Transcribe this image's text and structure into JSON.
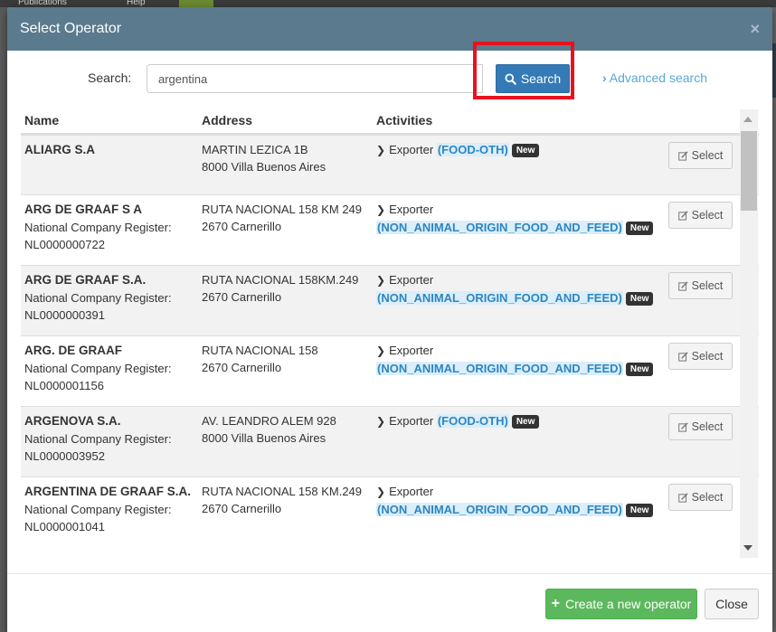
{
  "background": {
    "tab_publications": "Publications",
    "tab_help": "Help"
  },
  "modal": {
    "title": "Select Operator",
    "close_glyph": "×"
  },
  "search": {
    "label": "Search:",
    "value": "argentina",
    "button_label": "Search",
    "advanced_label": "Advanced search"
  },
  "table": {
    "headers": {
      "name": "Name",
      "address": "Address",
      "activities": "Activities"
    },
    "select_label": "Select",
    "rows": [
      {
        "name": "ALIARG S.A",
        "register": "",
        "address1": "MARTIN LEZICA 1B",
        "address2": "8000 Villa Buenos Aires",
        "activity": "Exporter",
        "code": "(FOOD-OTH)",
        "badge": "New"
      },
      {
        "name": "ARG DE GRAAF S A",
        "register": "National Company Register: NL0000000722",
        "address1": "RUTA NACIONAL 158 KM 249",
        "address2": "2670 Carnerillo",
        "activity": "Exporter",
        "code": "(NON_ANIMAL_ORIGIN_FOOD_AND_FEED)",
        "badge": "New"
      },
      {
        "name": "ARG DE GRAAF S.A.",
        "register": "National Company Register: NL0000000391",
        "address1": "RUTA NACIONAL 158KM.249",
        "address2": "2670 Carnerillo",
        "activity": "Exporter",
        "code": "(NON_ANIMAL_ORIGIN_FOOD_AND_FEED)",
        "badge": "New"
      },
      {
        "name": "ARG. DE GRAAF",
        "register": "National Company Register: NL0000001156",
        "address1": "RUTA NACIONAL 158",
        "address2": "2670 Carnerillo",
        "activity": "Exporter",
        "code": "(NON_ANIMAL_ORIGIN_FOOD_AND_FEED)",
        "badge": "New"
      },
      {
        "name": "ARGENOVA S.A.",
        "register": "National Company Register: NL0000003952",
        "address1": "AV. LEANDRO ALEM 928",
        "address2": "8000 Villa Buenos Aires",
        "activity": "Exporter",
        "code": "(FOOD-OTH)",
        "badge": "New"
      },
      {
        "name": "ARGENTINA DE GRAAF S.A.",
        "register": "National Company Register: NL0000001041",
        "address1": "RUTA NACIONAL 158 KM.249",
        "address2": "2670 Carnerillo",
        "activity": "Exporter",
        "code": "(NON_ANIMAL_ORIGIN_FOOD_AND_FEED)",
        "badge": "New"
      }
    ]
  },
  "footer": {
    "create_label": "Create a new operator",
    "close_label": "Close"
  },
  "colors": {
    "header": "#5b7a8d",
    "primary": "#337ab7",
    "success": "#5cb85c",
    "highlight": "#e8121e",
    "link": "#5aa7d4"
  }
}
